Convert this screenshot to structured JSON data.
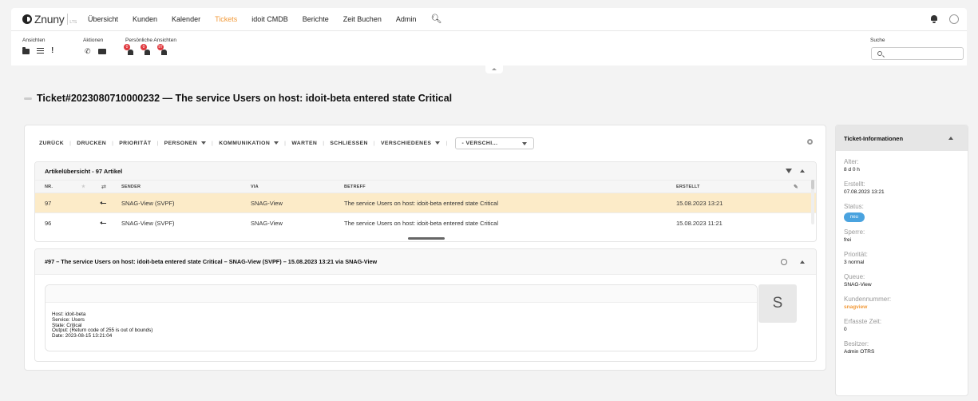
{
  "brand": {
    "name": "Znuny",
    "sub": "LTS"
  },
  "nav": [
    {
      "label": "Übersicht",
      "active": false
    },
    {
      "label": "Kunden",
      "active": false
    },
    {
      "label": "Kalender",
      "active": false
    },
    {
      "label": "Tickets",
      "active": true
    },
    {
      "label": "idoit CMDB",
      "active": false
    },
    {
      "label": "Berichte",
      "active": false
    },
    {
      "label": "Zeit Buchen",
      "active": false
    },
    {
      "label": "Admin",
      "active": false
    }
  ],
  "toolbar": {
    "views_label": "Ansichten",
    "actions_label": "Aktionen",
    "personal_label": "Persönliche Ansichten",
    "search_label": "Suche",
    "badges": [
      "0",
      "0",
      "97"
    ]
  },
  "ticket": {
    "title": "Ticket#2023080710000232 — The service Users on host: idoit-beta entered state Critical"
  },
  "actions": {
    "back": "ZURÜCK",
    "print": "DRUCKEN",
    "priority": "PRIORITÄT",
    "people": "PERSONEN",
    "communication": "KOMMUNIKATION",
    "pending": "WARTEN",
    "close": "SCHLIESSEN",
    "misc": "VERSCHIEDENES",
    "move": "- VERSCHI..."
  },
  "articles": {
    "header": "Artikelübersicht - 97 Artikel",
    "columns": {
      "nr": "NR.",
      "sender": "SENDER",
      "via": "VIA",
      "subject": "BETREFF",
      "created": "ERSTELLT"
    },
    "rows": [
      {
        "nr": "97",
        "sender": "SNAG-View (SVPF)",
        "via": "SNAG-View",
        "subject": "The service Users on host: idoit-beta entered state Critical",
        "created": "15.08.2023 13:21"
      },
      {
        "nr": "96",
        "sender": "SNAG-View (SVPF)",
        "via": "SNAG-View",
        "subject": "The service Users on host: idoit-beta entered state Critical",
        "created": "15.08.2023 11:21"
      }
    ]
  },
  "detail": {
    "header": "#97 – The service Users on host: idoit-beta entered state Critical – SNAG-View (SVPF) – 15.08.2023 13:21 via SNAG-View",
    "lines": [
      "Host: idoit-beta",
      "Service: Users",
      "State: Critical",
      "Output: (Return code of 255 is out of bounds)",
      "Date: 2023-08-15 13:21:04"
    ],
    "avatar_letter": "S"
  },
  "sidebar": {
    "title": "Ticket-Informationen",
    "fields": {
      "age": {
        "label": "Alter:",
        "value": "8 d 0 h"
      },
      "created": {
        "label": "Erstellt:",
        "value": "07.08.2023 13:21"
      },
      "status": {
        "label": "Status:",
        "value": "neu"
      },
      "lock": {
        "label": "Sperre:",
        "value": "frei"
      },
      "priority": {
        "label": "Priorität:",
        "value": "3 normal"
      },
      "queue": {
        "label": "Queue:",
        "value": "SNAG-View"
      },
      "customer": {
        "label": "Kundennummer:",
        "value": "snagview"
      },
      "time": {
        "label": "Erfasste Zeit:",
        "value": "0"
      },
      "owner": {
        "label": "Besitzer:",
        "value": "Admin OTRS"
      }
    }
  },
  "colors": {
    "accent": "#f29a3a",
    "selected_row": "#fcebc8",
    "status_badge": "#4aa3df",
    "notification": "#e0393e"
  }
}
